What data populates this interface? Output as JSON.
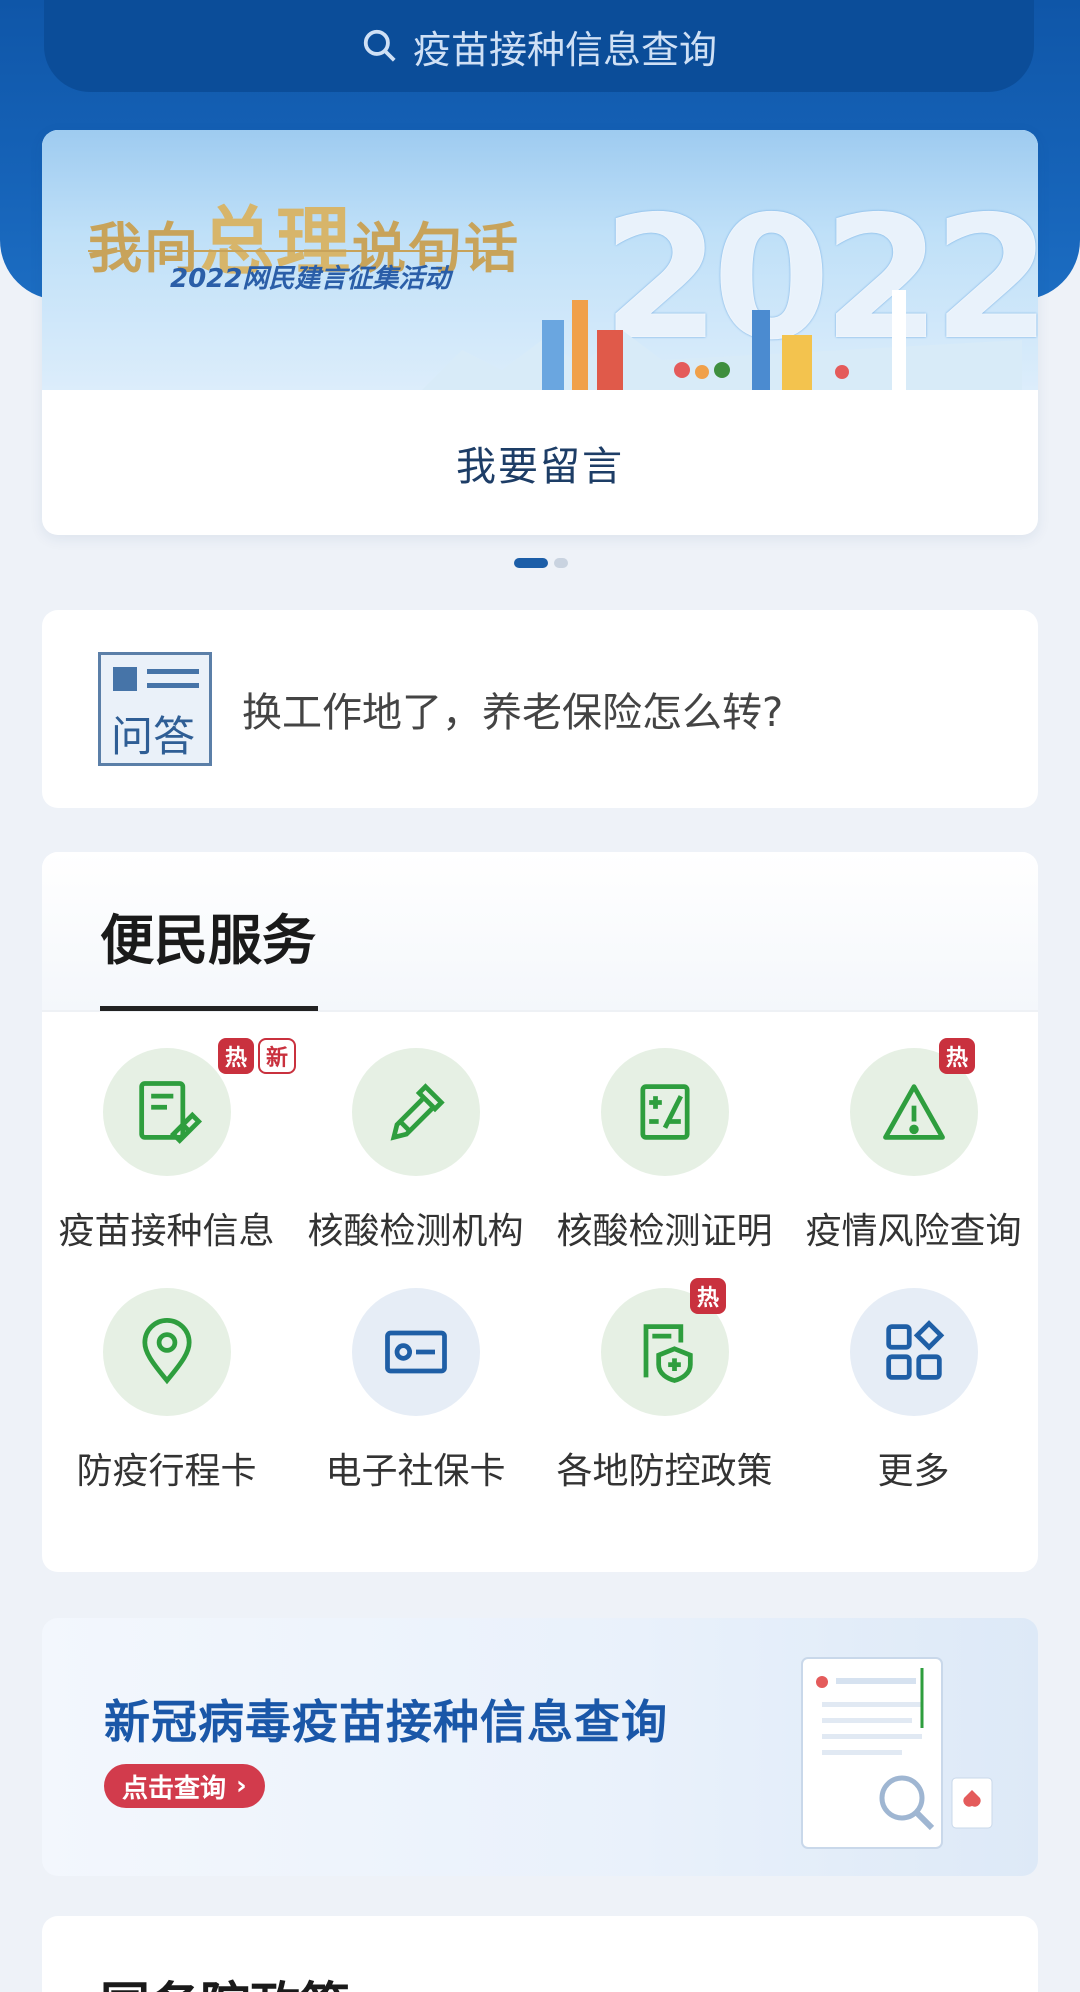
{
  "search": {
    "placeholder": "疫苗接种信息查询"
  },
  "banner": {
    "title_a": "我向",
    "title_b": "总理",
    "title_c": "说句话",
    "subtitle": "2022网民建言征集活动",
    "year": "2022",
    "action": "我要留言"
  },
  "carousel": {
    "current": 1,
    "total": 2
  },
  "qa": {
    "icon_text": "问答",
    "question": "换工作地了，养老保险怎么转?"
  },
  "services": {
    "title": "便民服务",
    "items": [
      {
        "label": "疫苗接种信息",
        "icon": "vaccine-record-icon",
        "badges": [
          "热",
          "新"
        ]
      },
      {
        "label": "核酸检测机构",
        "icon": "dropper-icon",
        "badges": []
      },
      {
        "label": "核酸检测证明",
        "icon": "calculator-icon",
        "badges": []
      },
      {
        "label": "疫情风险查询",
        "icon": "warning-icon",
        "badges": [
          "热"
        ]
      },
      {
        "label": "防疫行程卡",
        "icon": "location-pin-icon",
        "badges": []
      },
      {
        "label": "电子社保卡",
        "icon": "id-card-icon",
        "badges": []
      },
      {
        "label": "各地防控政策",
        "icon": "policy-shield-icon",
        "badges": [
          "热"
        ]
      },
      {
        "label": "更多",
        "icon": "grid-icon",
        "badges": []
      }
    ]
  },
  "promo": {
    "title": "新冠病毒疫苗接种信息查询",
    "button": "点击查询"
  },
  "next_section": {
    "title": "国务院政策"
  },
  "colors": {
    "primary": "#1663b8",
    "green": "#2e9e3e",
    "badge_red": "#c9313e",
    "blue_icon": "#1f5fa6"
  }
}
